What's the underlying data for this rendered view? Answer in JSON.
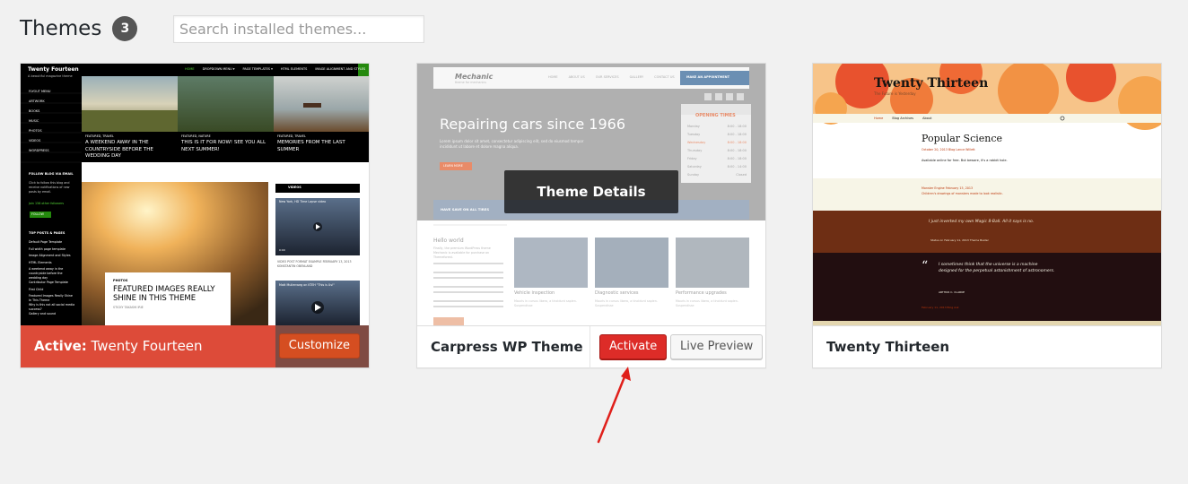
{
  "page": {
    "title": "Themes",
    "count": "3",
    "search_placeholder": "Search installed themes..."
  },
  "themes": [
    {
      "status_prefix": "Active:",
      "name": "Twenty Fourteen",
      "customize_label": "Customize",
      "preview": {
        "site_title": "Twenty Fourteen",
        "tagline": "A beautiful magazine theme",
        "menu": [
          "HOME",
          "DROPDOWN MENU ▾",
          "PAGE TEMPLATES ▾",
          "HTML ELEMENTS",
          "IMAGE ALIGNMENT AND STYLES"
        ],
        "sidebar": [
          "FLYOUT MENU",
          "ARTWORK",
          "BOOKS",
          "MUSIC",
          "PHOTOS",
          "VIDEOS",
          "WORDPRESS"
        ],
        "follow_title": "FOLLOW BLOG VIA EMAIL",
        "follow_text": "Click to follow this blog and receive notifications of new posts by email.",
        "follow_count": "Join 156 other followers",
        "follow_button": "FOLLOW",
        "top_posts_title": "TOP POSTS & PAGES",
        "top_posts": [
          "Default Page Template",
          "Full width page template",
          "Image Alignment and Styles",
          "HTML Elements",
          "A weekend away in the countryside before the wedding day",
          "Contributor Page Template",
          "First Child",
          "Featured Images Really Shine In This Theme",
          "Why is this not all social media success?",
          "Gallery and sound"
        ],
        "tiles": [
          {
            "category": "FEATURED, TRAVEL",
            "title": "A WEEKEND AWAY IN THE COUNTRYSIDE BEFORE THE WEDDING DAY"
          },
          {
            "category": "FEATURED, NATURE",
            "title": "THIS IS IT FOR NOW! SEE YOU ALL NEXT SUMMER!"
          },
          {
            "category": "FEATURED, TRAVEL",
            "title": "MEMORIES FROM THE LAST SUMMER"
          }
        ],
        "post_category": "PHOTOS",
        "post_title": "FEATURED IMAGES REALLY SHINE IN THIS THEME",
        "post_meta": "STICKY   TAKASHI IRIE",
        "videos_title": "VIDEOS",
        "video1_title": "New York, HD Time Lapse video",
        "video1_time": "0:00",
        "video_caption": "VIDEO POST FORMAT EXAMPLE  FEBRUARY 13, 2013  KONSTANTIN OBENLAND",
        "video2_title": "Matt Mullenweg on KTEH \"This is Us!\""
      }
    },
    {
      "name": "Carpress WP Theme",
      "details_label": "Theme Details",
      "activate_label": "Activate",
      "live_preview_label": "Live Preview",
      "preview": {
        "logo": "Mechanic",
        "logo_sub": "theme for mechanics",
        "nav": [
          "HOME",
          "ABOUT US",
          "OUR SERVICES",
          "GALLERY",
          "CONTACT US"
        ],
        "cta": "MAKE AN APPOINTMENT",
        "hero_title": "Repairing cars since 1966",
        "hero_text": "Lorem ipsum dolor sit amet, consectetur adipiscing elit, sed do eiusmod tempor incididunt ut labore et dolore magna aliqua.",
        "hero_button": "LEARN MORE",
        "hours_title": "OPENING TIMES",
        "hours": [
          {
            "day": "Monday",
            "time": "8:00 - 18:00"
          },
          {
            "day": "Tuesday",
            "time": "8:00 - 18:00"
          },
          {
            "day": "Wednesday",
            "time": "8:00 - 18:00"
          },
          {
            "day": "Thursday",
            "time": "8:00 - 18:00"
          },
          {
            "day": "Friday",
            "time": "8:00 - 18:00"
          },
          {
            "day": "Saturday",
            "time": "8:00 - 14:00"
          },
          {
            "day": "Sunday",
            "time": "Closed"
          }
        ],
        "strip_text": "HAVE SAVE ON ALL TIRES",
        "hello_title": "Hello world",
        "hello_text": "Finally, the premium WordPress theme Mechanic is available for purchase on Themeforest.",
        "services": [
          {
            "title": "Vehicle inspection",
            "text": "Mauris in cursus libero, a tincidunt sapien. Suspendisse"
          },
          {
            "title": "Diagnostic services",
            "text": "Mauris in cursus libero, a tincidunt sapien. Suspendisse"
          },
          {
            "title": "Performance upgrades",
            "text": "Mauris in cursus libero, a tincidunt sapien. Suspendisse"
          }
        ]
      }
    },
    {
      "name": "Twenty Thirteen",
      "preview": {
        "site_title": "Twenty Thirteen",
        "tagline": "The Future is Yesterday",
        "nav": [
          "Home",
          "Blog Archives",
          "About"
        ],
        "post_title": "Popular Science",
        "post_meta": "October 20, 2013   Blog   Lance Willett",
        "post_text": "Available online for free. But beware, it's a rabbit hole.",
        "aside_meta": "Monster Engine   February 15, 2013",
        "aside_text": "Children's drawings of monsters made to look realistic.",
        "status_text": "I just inverted my own Magic 8-Ball. All it says is no.",
        "status_meta": "Status on February 11, 2013   Theme Buster",
        "quote_text": "I sometimes think that the universe is a machine designed for the perpetual astonishment of astronomers.",
        "quote_author": "ARTHUR C. CLARKE",
        "quote_meta": "February 11, 2013   Blog   Ask"
      }
    }
  ],
  "colors": {
    "active_bar": "#dd4b39",
    "activate_button": "#dd2c28",
    "annotation_arrow": "#e0201b"
  }
}
